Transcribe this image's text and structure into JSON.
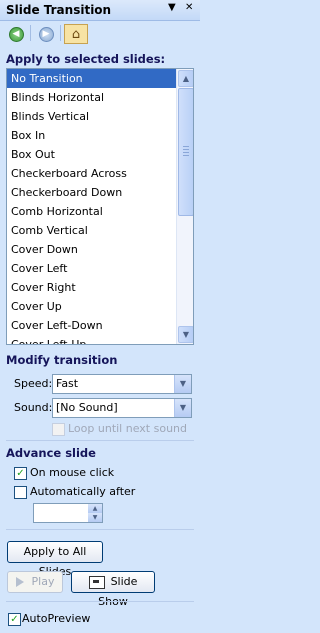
{
  "pane": {
    "title": "Slide Transition",
    "menu_glyph": "▼",
    "close_glyph": "✕"
  },
  "nav": {
    "back_glyph": "◀",
    "forward_glyph": "▶",
    "home_glyph": "⌂"
  },
  "apply_section": {
    "heading": "Apply to selected slides:",
    "items": [
      "No Transition",
      "Blinds Horizontal",
      "Blinds Vertical",
      "Box In",
      "Box Out",
      "Checkerboard Across",
      "Checkerboard Down",
      "Comb Horizontal",
      "Comb Vertical",
      "Cover Down",
      "Cover Left",
      "Cover Right",
      "Cover Up",
      "Cover Left-Down",
      "Cover Left-Up"
    ],
    "selected_index": 0
  },
  "modify": {
    "heading": "Modify transition",
    "speed_label": "Speed:",
    "speed_value": "Fast",
    "sound_label": "Sound:",
    "sound_value": "[No Sound]",
    "loop_label": "Loop until next sound",
    "loop_checked": false
  },
  "advance": {
    "heading": "Advance slide",
    "mouse_click_label": "On mouse click",
    "mouse_click_checked": true,
    "auto_label": "Automatically after",
    "auto_checked": false,
    "auto_value": ""
  },
  "buttons": {
    "apply_all": "Apply to All Slides",
    "play": "Play",
    "slide_show": "Slide Show"
  },
  "autopreview": {
    "label": "AutoPreview",
    "checked": true
  },
  "colors": {
    "pane_bg": "#d3e5fb",
    "selection": "#316ac5",
    "heading_text": "#15155a"
  }
}
